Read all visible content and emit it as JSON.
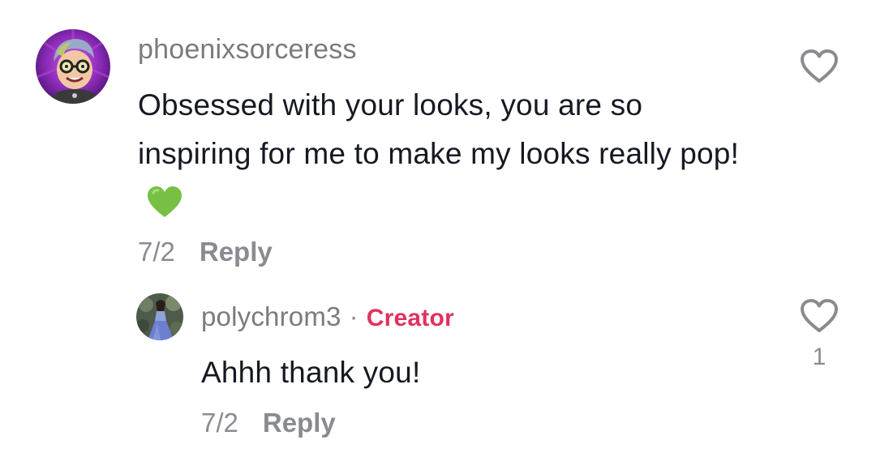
{
  "comments": [
    {
      "username": "phoenixsorceress",
      "text": "Obsessed with your looks, you are so inspiring for me to make my looks really pop!",
      "emoji": "green-heart",
      "date": "7/2",
      "reply_label": "Reply",
      "like_count": ""
    }
  ],
  "reply": {
    "username": "polychrom3",
    "separator": "·",
    "badge": "Creator",
    "text": "Ahhh thank you!",
    "date": "7/2",
    "reply_label": "Reply",
    "like_count": "1"
  },
  "colors": {
    "text_primary": "#161823",
    "text_secondary": "#8a8b91",
    "creator_badge": "#e0325c",
    "emoji_heart": "#77c043"
  }
}
